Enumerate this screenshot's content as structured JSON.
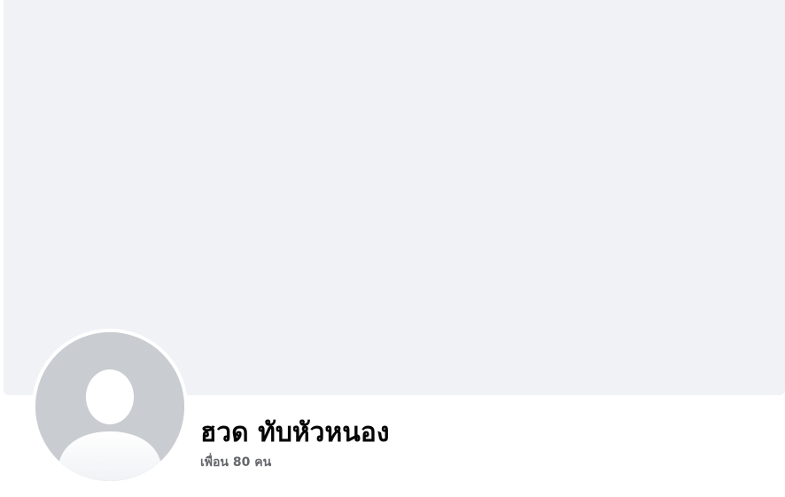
{
  "profile": {
    "name": "ฮวด ทับหัวหนอง",
    "friends_count_label": "เพื่อน 80 คน"
  },
  "icons": {
    "avatar": "default-person-silhouette-icon"
  },
  "colors": {
    "cover_background": "#f0f2f5",
    "avatar_background": "#c9ccd1",
    "avatar_silhouette": "#ffffff",
    "name_text": "#050505",
    "secondary_text": "#65676b"
  }
}
